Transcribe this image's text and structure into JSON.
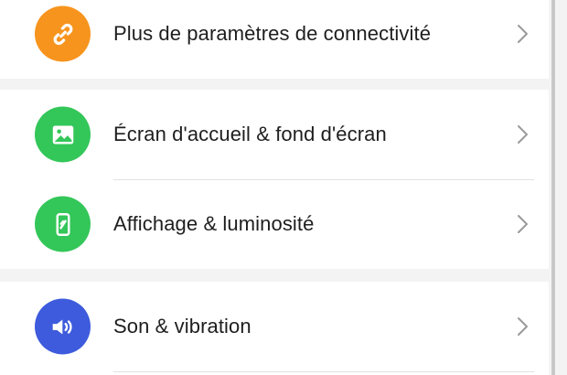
{
  "settings_list": {
    "items": [
      {
        "label": "Plus de paramètres de connectivité",
        "icon": "link-icon",
        "icon_color": "#f7941d"
      },
      {
        "label": "Écran d'accueil & fond d'écran",
        "icon": "image-icon",
        "icon_color": "#33c659"
      },
      {
        "label": "Affichage & luminosité",
        "icon": "phone-display-icon",
        "icon_color": "#33c659"
      },
      {
        "label": "Son & vibration",
        "icon": "speaker-icon",
        "icon_color": "#3d5bdc"
      }
    ]
  }
}
